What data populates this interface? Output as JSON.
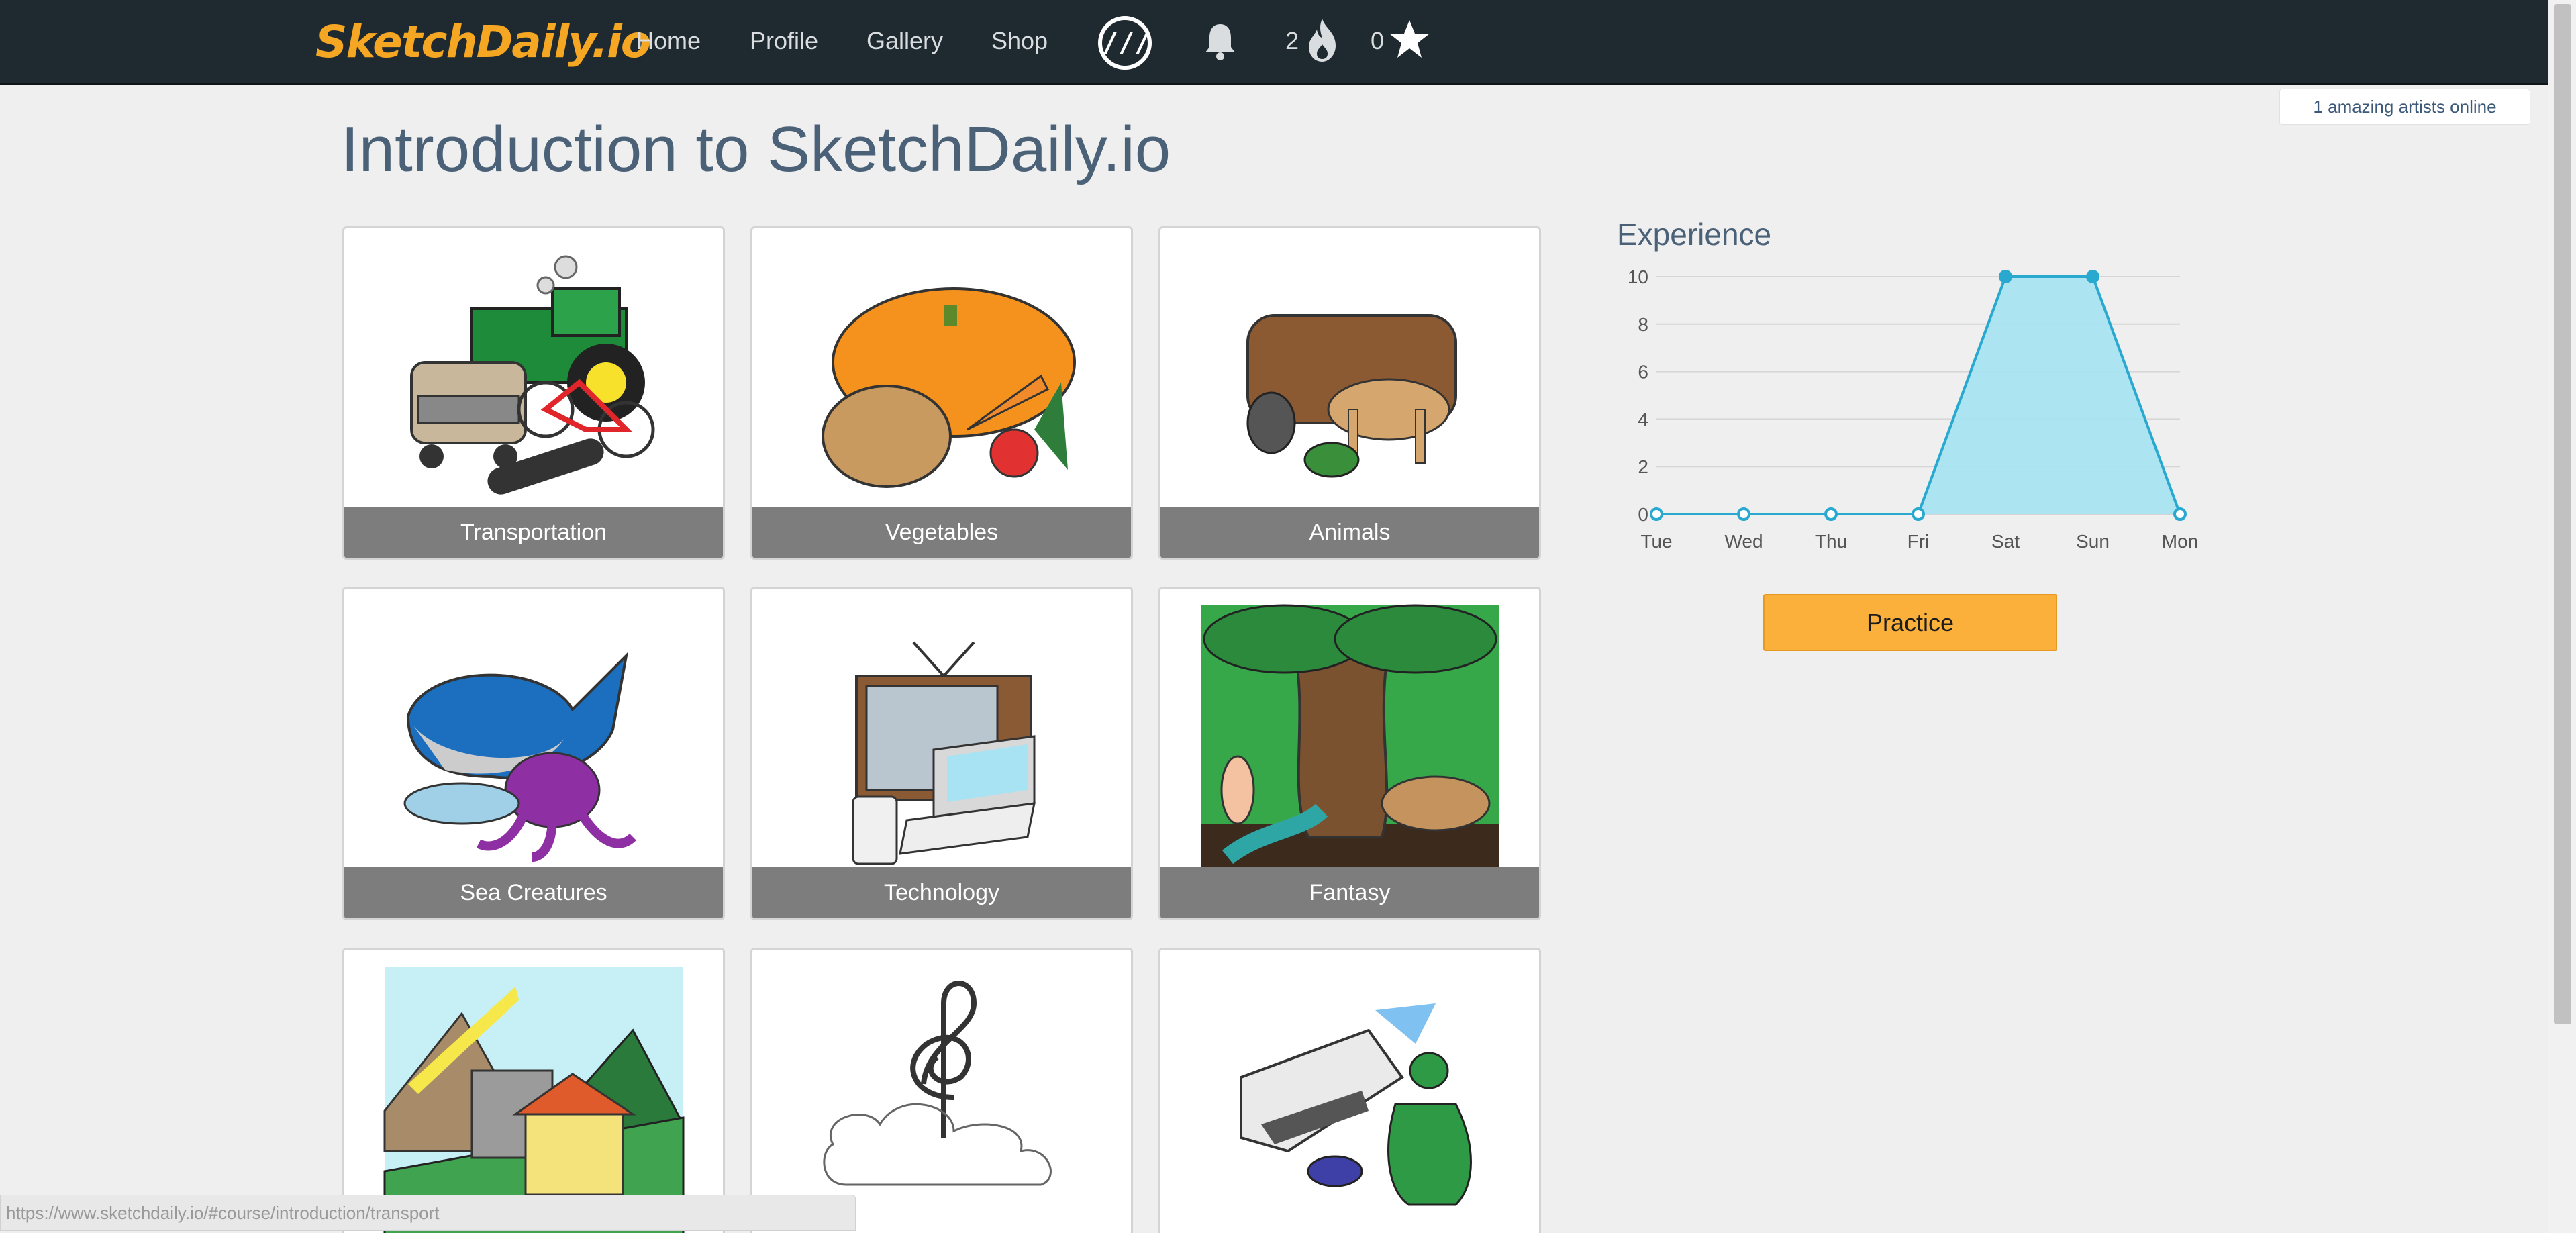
{
  "nav": {
    "brand": "SketchDaily.io",
    "links": [
      "Home",
      "Profile",
      "Gallery",
      "Shop"
    ],
    "streak_count": "2",
    "star_count": "0",
    "logo_text": "///"
  },
  "online_badge": "1 amazing artists online",
  "page_title": "Introduction to SketchDaily.io",
  "tiles": [
    {
      "label": "Transportation"
    },
    {
      "label": "Vegetables"
    },
    {
      "label": "Animals"
    },
    {
      "label": "Sea Creatures"
    },
    {
      "label": "Technology"
    },
    {
      "label": "Fantasy"
    },
    {
      "label": ""
    },
    {
      "label": ""
    },
    {
      "label": ""
    }
  ],
  "experience": {
    "title": "Experience",
    "practice_label": "Practice"
  },
  "chart_data": {
    "type": "area",
    "x": [
      "Tue",
      "Wed",
      "Thu",
      "Fri",
      "Sat",
      "Sun",
      "Mon"
    ],
    "series": [
      {
        "values": [
          0,
          0,
          0,
          0,
          10,
          10,
          0
        ]
      }
    ],
    "ylim": [
      0,
      10
    ],
    "yticks": [
      0,
      2,
      4,
      6,
      8,
      10
    ],
    "grid": true,
    "fill_color": "#a8e3f1",
    "line_color": "#2aa9d0"
  },
  "status_url": "https://www.sketchdaily.io/#course/introduction/transport",
  "colors": {
    "navbar": "#1f2a30",
    "brand": "#f5a623",
    "practice": "#fbb03b",
    "label_bar": "#7d7d7d"
  }
}
